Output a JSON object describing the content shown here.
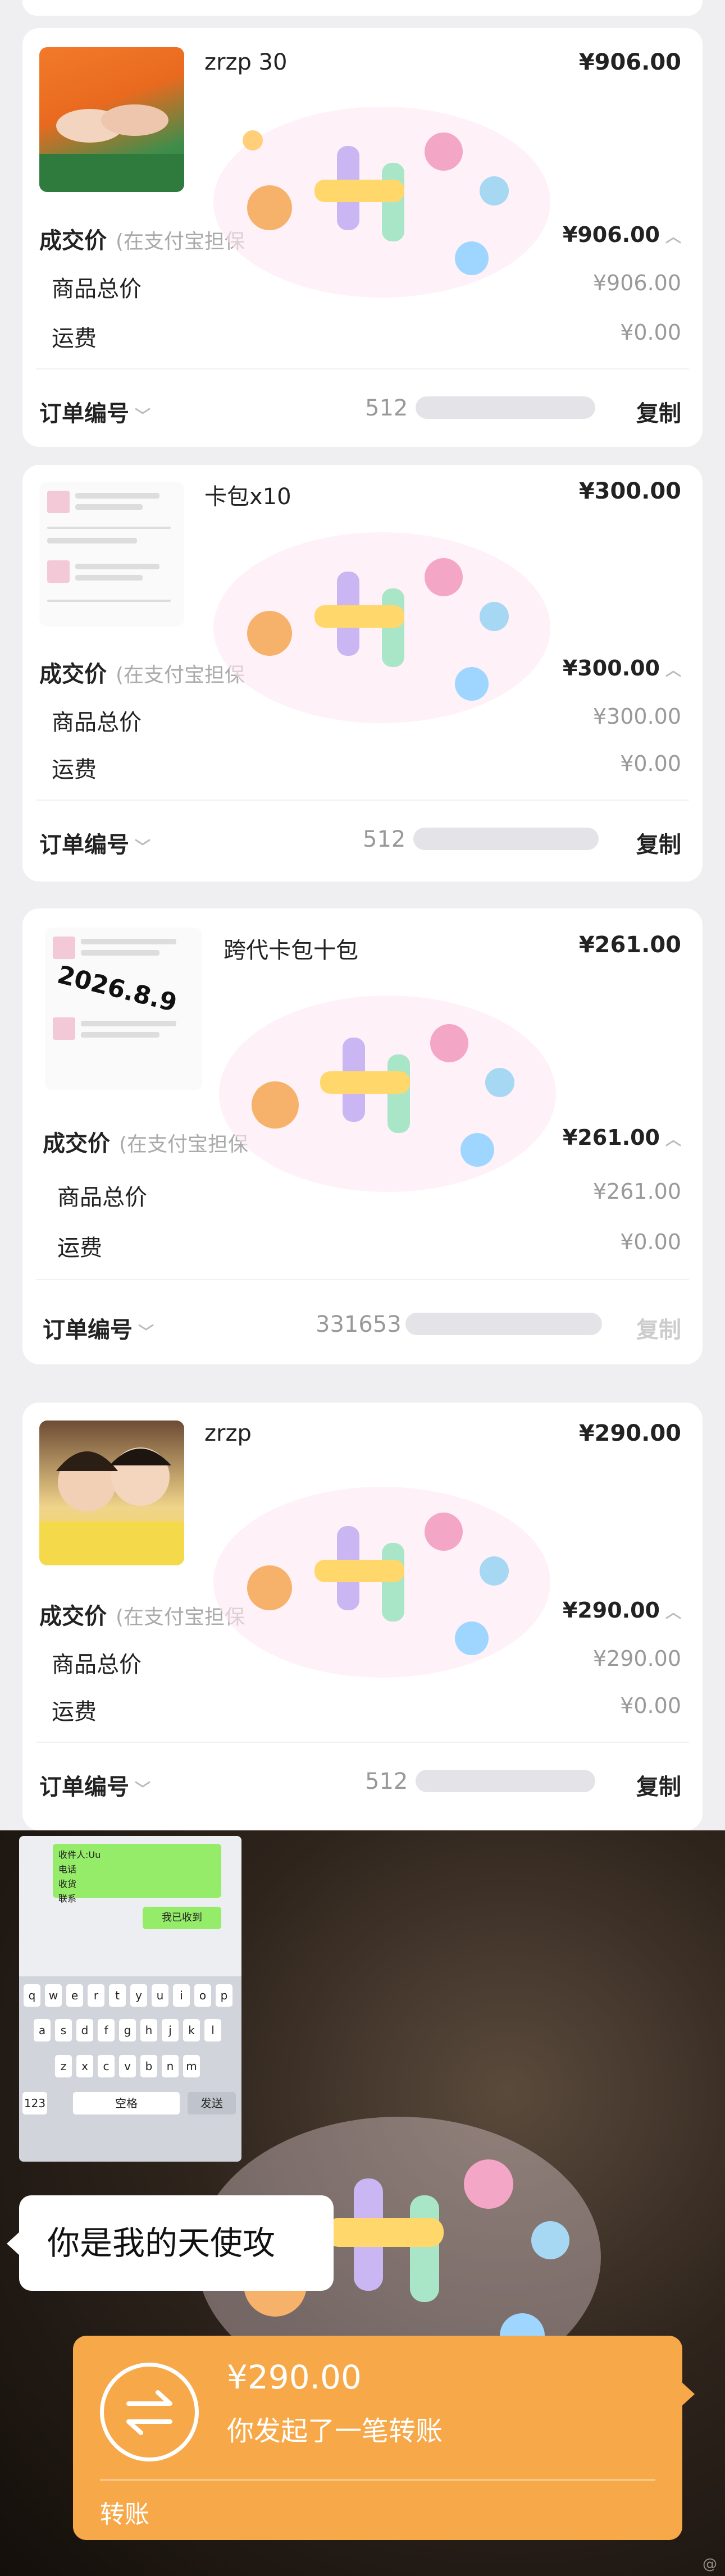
{
  "orders": [
    {
      "title": "zrzp 30",
      "price": "¥906.00",
      "deal_label": "成交价",
      "deal_sub": "(在支付宝担保",
      "deal_value": "¥906.00",
      "goods_label": "商品总价",
      "goods_value": "¥906.00",
      "shipping_label": "运费",
      "shipping_value": "¥0.00",
      "order_no_label": "订单编号",
      "order_no_prefix": "512",
      "copy_label": "复制"
    },
    {
      "title": "卡包x10",
      "price": "¥300.00",
      "deal_label": "成交价",
      "deal_sub": "(在支付宝担保",
      "deal_value": "¥300.00",
      "goods_label": "商品总价",
      "goods_value": "¥300.00",
      "shipping_label": "运费",
      "shipping_value": "¥0.00",
      "order_no_label": "订单编号",
      "order_no_prefix": "512",
      "copy_label": "复制"
    },
    {
      "title": "跨代卡包十包",
      "price": "¥261.00",
      "date_overlay": "2026.8.9",
      "deal_label": "成交价",
      "deal_sub": "(在支付宝担保",
      "deal_value": "¥261.00",
      "goods_label": "商品总价",
      "goods_value": "¥261.00",
      "shipping_label": "运费",
      "shipping_value": "¥0.00",
      "order_no_label": "订单编号",
      "order_no_prefix": "331653",
      "copy_label": "复制"
    },
    {
      "title": "zrzp",
      "price": "¥290.00",
      "deal_label": "成交价",
      "deal_sub": "(在支付宝担保",
      "deal_value": "¥290.00",
      "goods_label": "商品总价",
      "goods_value": "¥290.00",
      "shipping_label": "运费",
      "shipping_value": "¥0.00",
      "order_no_label": "订单编号",
      "order_no_prefix": "512",
      "copy_label": "复制"
    }
  ],
  "chat": {
    "bubble_lines": [
      "收件人:Uu",
      "电话",
      "收货",
      "联系"
    ],
    "small_bubble": "我已收到",
    "keyboard_row1": [
      "q",
      "w",
      "e",
      "r",
      "t",
      "y",
      "u",
      "i",
      "o",
      "p"
    ],
    "keyboard_row2": [
      "a",
      "s",
      "d",
      "f",
      "g",
      "h",
      "j",
      "k",
      "l"
    ],
    "keyboard_row3": [
      "z",
      "x",
      "c",
      "v",
      "b",
      "n",
      "m"
    ],
    "space_label": "空格",
    "send_label": "发送",
    "num_label": "123"
  },
  "speech_text": "你是我的天使攻",
  "transfer": {
    "amount": "¥290.00",
    "description": "你发起了一笔转账",
    "label": "转账"
  },
  "icons": {
    "arrow_caret": "chevron-down-icon",
    "transfer": "transfer-arrows-icon"
  },
  "colors": {
    "transfer_bg": "#f7a94a",
    "wechat_green": "#95ec69"
  }
}
